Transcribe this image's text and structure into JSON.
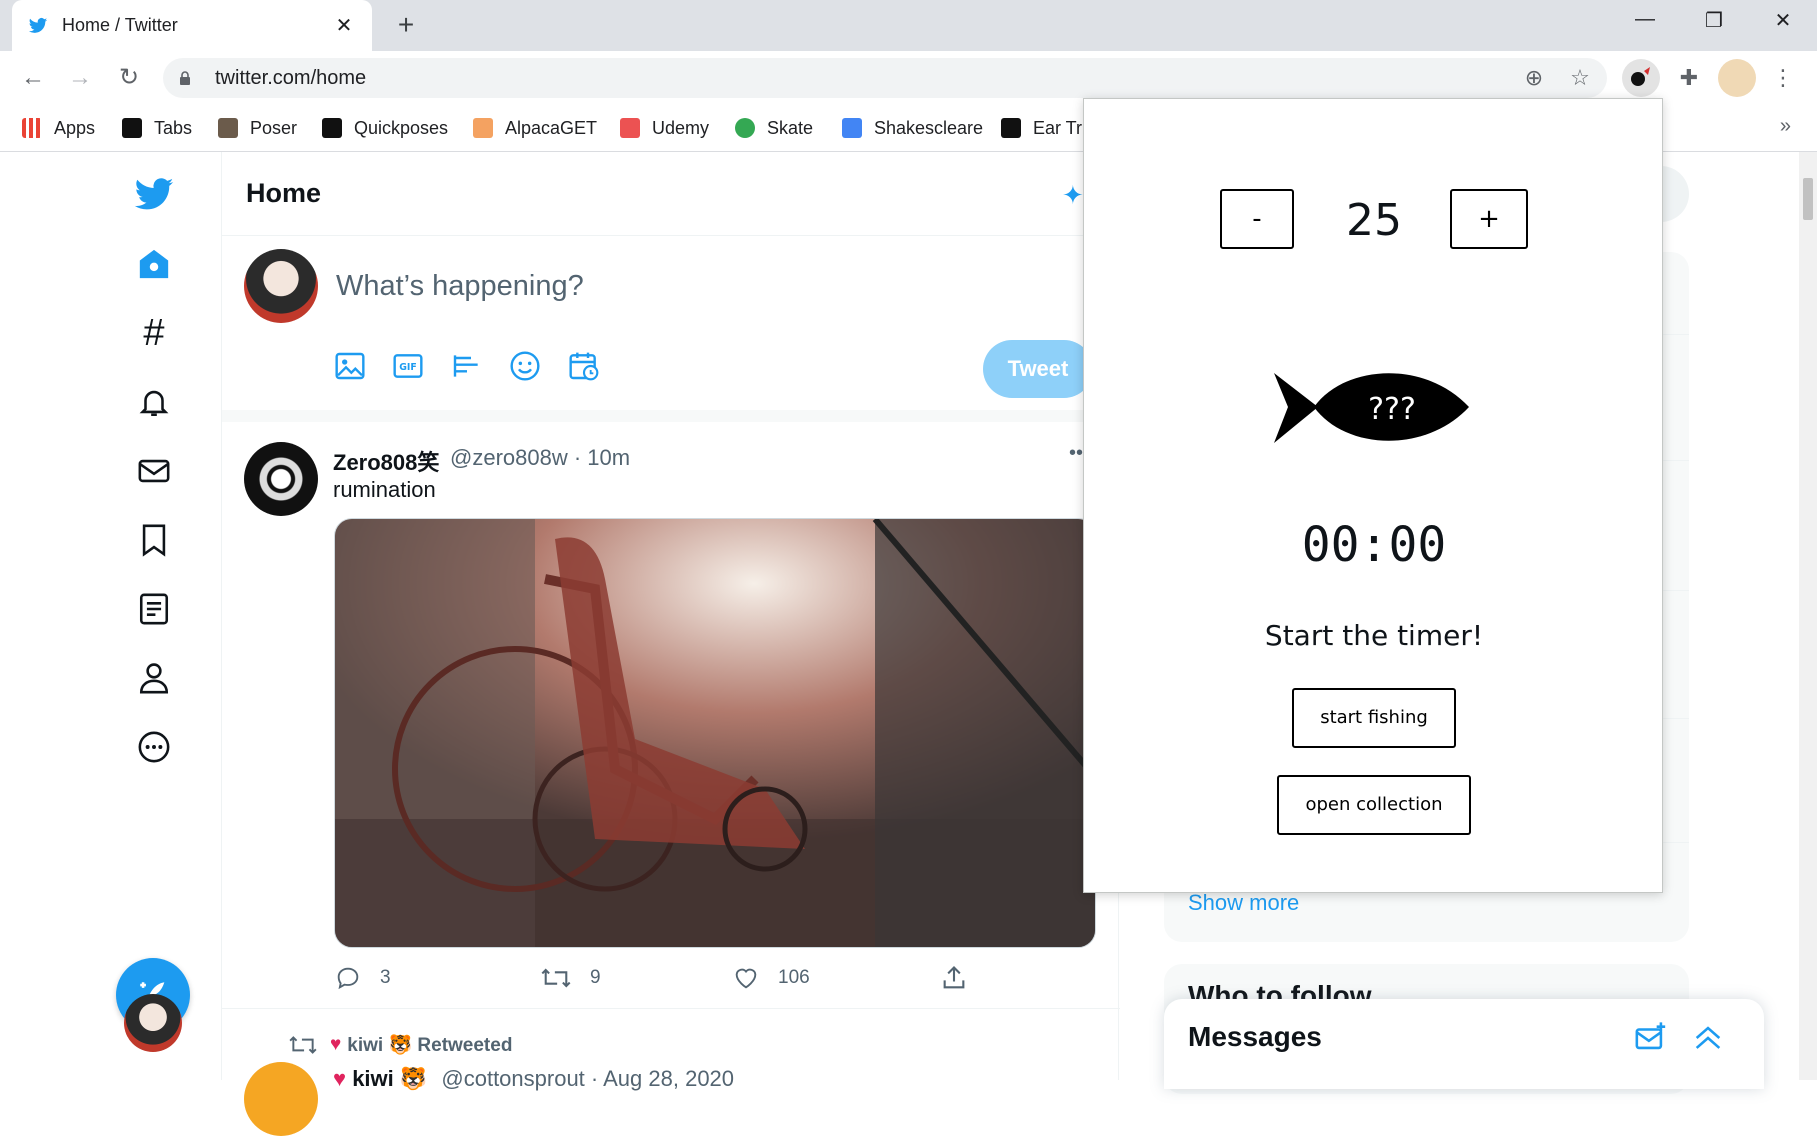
{
  "browser": {
    "tab_title": "Home / Twitter",
    "new_tab_label": "+",
    "url": "twitter.com/home",
    "bookmarks": [
      {
        "label": "Apps",
        "color": "#ea4335"
      },
      {
        "label": "Tabs",
        "color": "#111111"
      },
      {
        "label": "Poser",
        "color": "#6b5b4b"
      },
      {
        "label": "Quickposes",
        "color": "#111111"
      },
      {
        "label": "AlpacaGET",
        "color": "#f4a261"
      },
      {
        "label": "Udemy",
        "color": "#ec5252"
      },
      {
        "label": "Skate",
        "color": "#34a853"
      },
      {
        "label": "Shakescleare",
        "color": "#4285f4"
      },
      {
        "label": "Ear Tr",
        "color": "#111111"
      }
    ],
    "bookmarks_overflow": "»"
  },
  "twitter": {
    "page_title": "Home",
    "compose_placeholder": "What’s happening?",
    "tweet_button": "Tweet",
    "tweet": {
      "name": "Zero808笑",
      "handle_time": "@zero808w · 10m",
      "text": "rumination",
      "replies": "3",
      "retweets": "9",
      "likes": "106"
    },
    "retweeted_by": "kiwi 🐯 Retweeted",
    "next_tweet_name": "kiwi 🐯",
    "next_tweet_handle": "@cottonsprout · Aug 28, 2020",
    "show_more": "Show more",
    "who_to_follow": "Who to follow",
    "messages_title": "Messages",
    "accent_color": "#1d9bf0"
  },
  "popup": {
    "minus_label": "-",
    "plus_label": "+",
    "minutes": "25",
    "fish_label": "???",
    "timer": "00:00",
    "status": "Start the timer!",
    "start_button": "start fishing",
    "collection_button": "open collection"
  }
}
